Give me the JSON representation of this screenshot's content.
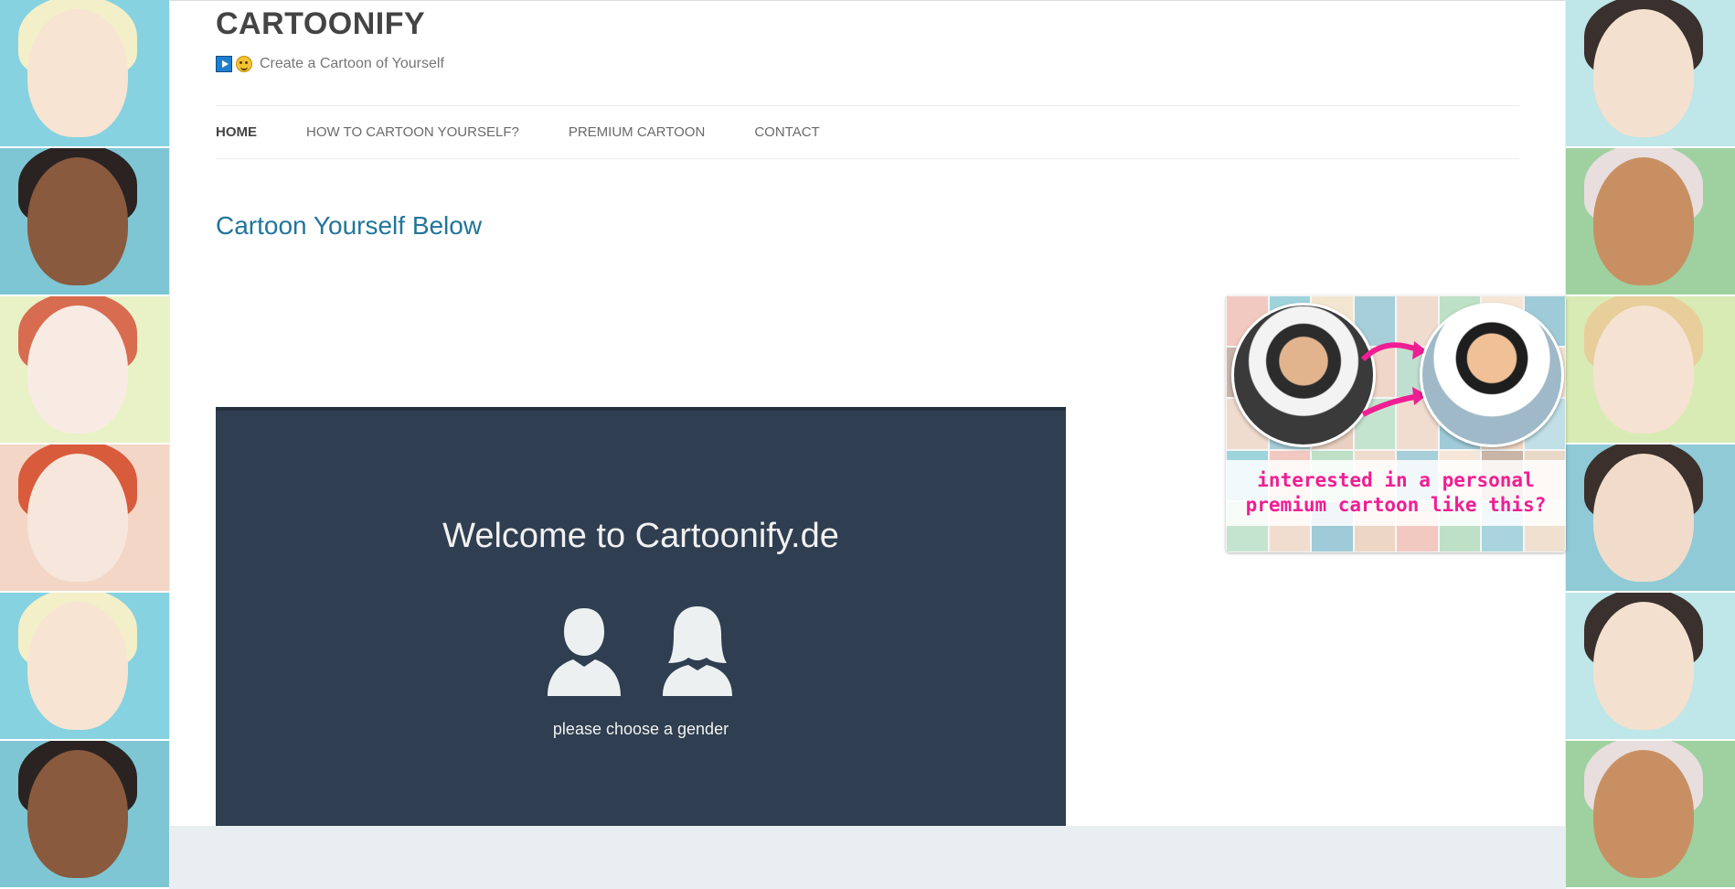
{
  "site": {
    "title": "CARTOONIFY",
    "tagline": "Create a Cartoon of Yourself",
    "tagline_icons": [
      "play-button-icon",
      "smiley-icon"
    ]
  },
  "nav": {
    "items": [
      {
        "label": "HOME",
        "active": true
      },
      {
        "label": "HOW TO CARTOON YOURSELF?",
        "active": false
      },
      {
        "label": "PREMIUM CARTOON",
        "active": false
      },
      {
        "label": "CONTACT",
        "active": false
      }
    ]
  },
  "content": {
    "title": "Cartoon Yourself Below"
  },
  "app": {
    "title": "Welcome to Cartoonify.de",
    "gender_icons": [
      "male-silhouette-icon",
      "female-silhouette-icon"
    ],
    "hint": "please choose a gender"
  },
  "promo": {
    "line1": "interested in a personal",
    "line2": "premium cartoon like this?"
  },
  "colors": {
    "link": "#21759b",
    "app_bg": "#2f3e50",
    "promo_text": "#f01e93"
  }
}
